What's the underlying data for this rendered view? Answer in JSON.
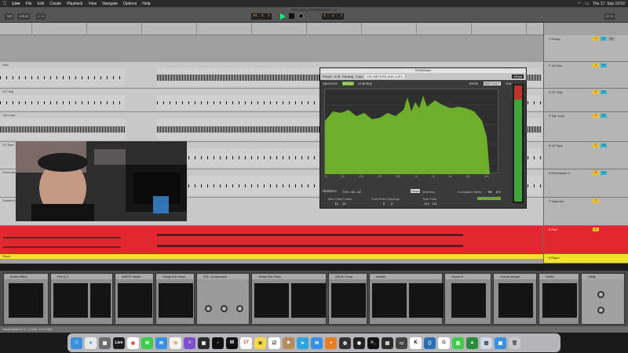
{
  "menubar": {
    "app": "Live",
    "items": [
      "File",
      "Edit",
      "Create",
      "Playback",
      "View",
      "Navigate",
      "Options",
      "Help"
    ],
    "clock": "Thu 17. Sep 19:52"
  },
  "transport": {
    "window_title": "Thin Line_Foosmismaster.v.h",
    "tap_label": "TAP",
    "tempo": "128.00",
    "signature": "4 / 4",
    "position": "93. 3. 1",
    "loop_end": "1 . 1 . 1",
    "cpu": "20 %"
  },
  "tracks": [
    {
      "name": "1 Group",
      "label": "Main",
      "number": "1"
    },
    {
      "name": "2 V2 Kick",
      "label": "Kick",
      "number": "2"
    },
    {
      "name": "3 V2 Clap",
      "label": "V2 Clap",
      "number": "3"
    },
    {
      "name": "4 Top Loop",
      "label": "Top Loop",
      "number": "4"
    },
    {
      "name": "5 V2 Tops",
      "label": "V2 Tops",
      "number": "5"
    },
    {
      "name": "6 Percussion V",
      "label": "Percussion",
      "number": "6"
    },
    {
      "name": "7 Scanned",
      "label": "Scanned",
      "number": "7"
    },
    {
      "name": "8 Pad",
      "label": "Pad",
      "number": "8"
    },
    {
      "name": "9 Piano",
      "label": "Piano",
      "number": "9"
    }
  ],
  "span": {
    "title": "SPAN/Main",
    "preset": "Preset",
    "routing": "Routing",
    "sidechain": "A+B",
    "copy": "Copy",
    "meter_mode": "K20 METERS AND LUFS",
    "logo": "SPAN",
    "spectrum_label": "Spectrum",
    "hold": "HOLD",
    "underlay": "Underlay",
    "mode_label": "Mode",
    "mode": "DEFAULT",
    "out_label": "Out",
    "statistics": "Statistics",
    "rms": "RMS",
    "rms_value": "-13",
    "rms_value2": "-12",
    "max_crest_label": "Max Crest Factor",
    "max_crest_values": [
      "13",
      "13"
    ],
    "true_peak_clip_label": "True Peak Clippings",
    "true_peak_clip_values": [
      "0",
      "0"
    ],
    "true_peak_label": "True Peak",
    "true_peak_values": [
      "-0.1",
      "-0.1"
    ],
    "reset": "Reset",
    "metering": "Metering",
    "correlation_label": "Correlation Meter",
    "correlation_value": "96",
    "correlation_value2": "0.0",
    "freq_ticks": [
      "20",
      "50",
      "100",
      "200",
      "500",
      "1k",
      "2k",
      "5k",
      "10k",
      "20k"
    ]
  },
  "devices": [
    {
      "name": "Audio Effect",
      "selected": "Fade"
    },
    {
      "name": "Pro-Q 3",
      "selected": "Fade"
    },
    {
      "name": "VASTR Meter",
      "selected": "Fade"
    },
    {
      "name": "Virtual Mix Rack",
      "selected": "Fade"
    },
    {
      "name": "SSL Compressor",
      "selected": "Fade"
    },
    {
      "name": "Virtual Mix Rack",
      "selected": "Fade"
    },
    {
      "name": "SSLN Comp",
      "selected": "Fade"
    },
    {
      "name": "invisibl",
      "selected": "Fade"
    },
    {
      "name": "Ozone 9",
      "selected": "Fade"
    },
    {
      "name": "Ozone Imager",
      "selected": "Fade"
    },
    {
      "name": "SPAN",
      "selected": "Fade"
    },
    {
      "name": "Utility",
      "selected": "Fade"
    }
  ],
  "statusbar": {
    "text": "Insert Mark 47.1.1 (Time: 2:41:000)"
  },
  "colors": {
    "red_track": "#e3282f",
    "yellow_track": "#f2e229",
    "spectrum": "#6dae2c",
    "play": "#00ff6a"
  },
  "dock": {
    "icons": [
      "finder-icon",
      "safari-icon",
      "launchpad-icon",
      "live-icon",
      "chrome-icon",
      "messages-icon",
      "mail-icon",
      "photos-icon",
      "stacks-icon",
      "app-icon",
      "music-icon",
      "ableton-icon",
      "calendar-icon",
      "notes-icon",
      "reminders-icon",
      "contacts-icon",
      "telegram-icon",
      "mail2-icon",
      "blender-icon",
      "obs-icon",
      "eye-icon",
      "terminal-icon",
      "terminal2-icon",
      "screen-icon",
      "kontakt-icon",
      "vscode-icon",
      "g-icon",
      "numbers-icon",
      "monitor-icon",
      "preview-icon",
      "finder2-icon",
      "trash-icon"
    ]
  }
}
